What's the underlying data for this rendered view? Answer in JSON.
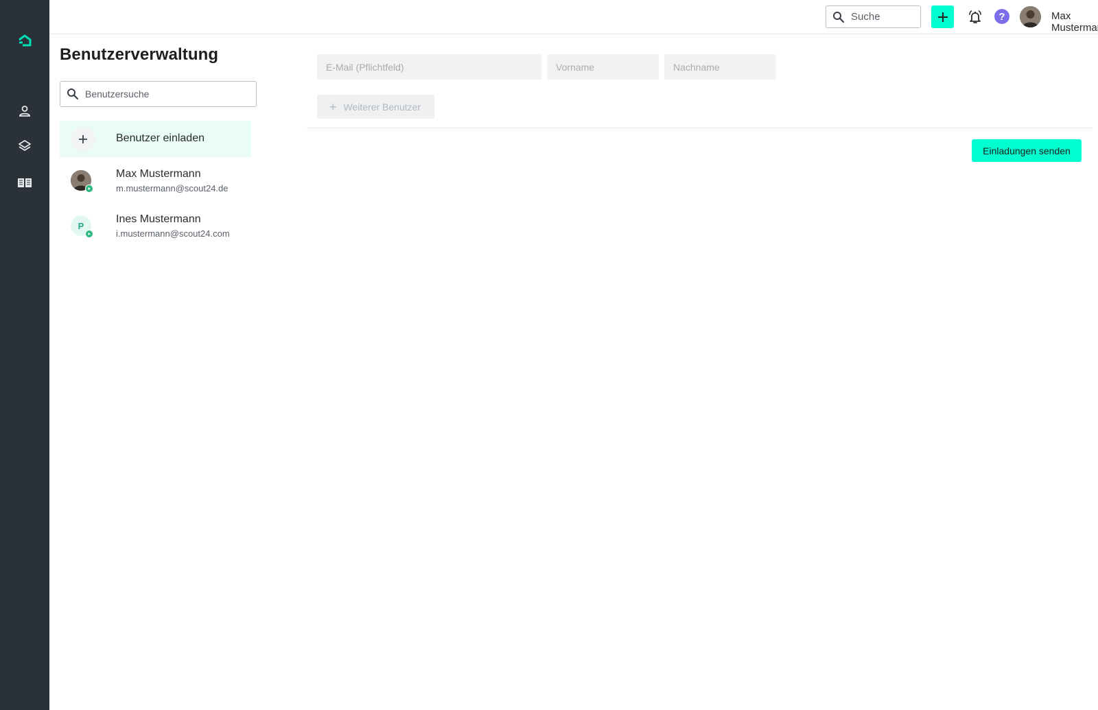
{
  "colors": {
    "sidebar_bg": "#2b3138",
    "accent": "#00ffd0",
    "invite_row_bg": "#e9fcf6",
    "help_purple": "#7b6ee8",
    "online_badge": "#2ab87d"
  },
  "sidebar": {
    "items": [
      {
        "icon": "logo-icon"
      },
      {
        "icon": "user-icon"
      },
      {
        "icon": "layers-icon"
      },
      {
        "icon": "book-icon"
      }
    ]
  },
  "topbar": {
    "search_placeholder": "Suche",
    "user_name": "Max Mustermann"
  },
  "page": {
    "title": "Benutzerverwaltung",
    "user_search_placeholder": "Benutzersuche",
    "invite_label": "Benutzer einladen",
    "users": [
      {
        "name": "Max Mustermann",
        "email": "m.mustermann@scout24.de",
        "avatar": "photo"
      },
      {
        "name": "Ines Mustermann",
        "email": "i.mustermann@scout24.com",
        "avatar_letter": "P"
      }
    ]
  },
  "form": {
    "email_placeholder": "E-Mail (Pflichtfeld)",
    "firstname_placeholder": "Vorname",
    "lastname_placeholder": "Nachname",
    "more_users_label": "Weiterer Benutzer",
    "send_label": "Einladungen senden"
  }
}
